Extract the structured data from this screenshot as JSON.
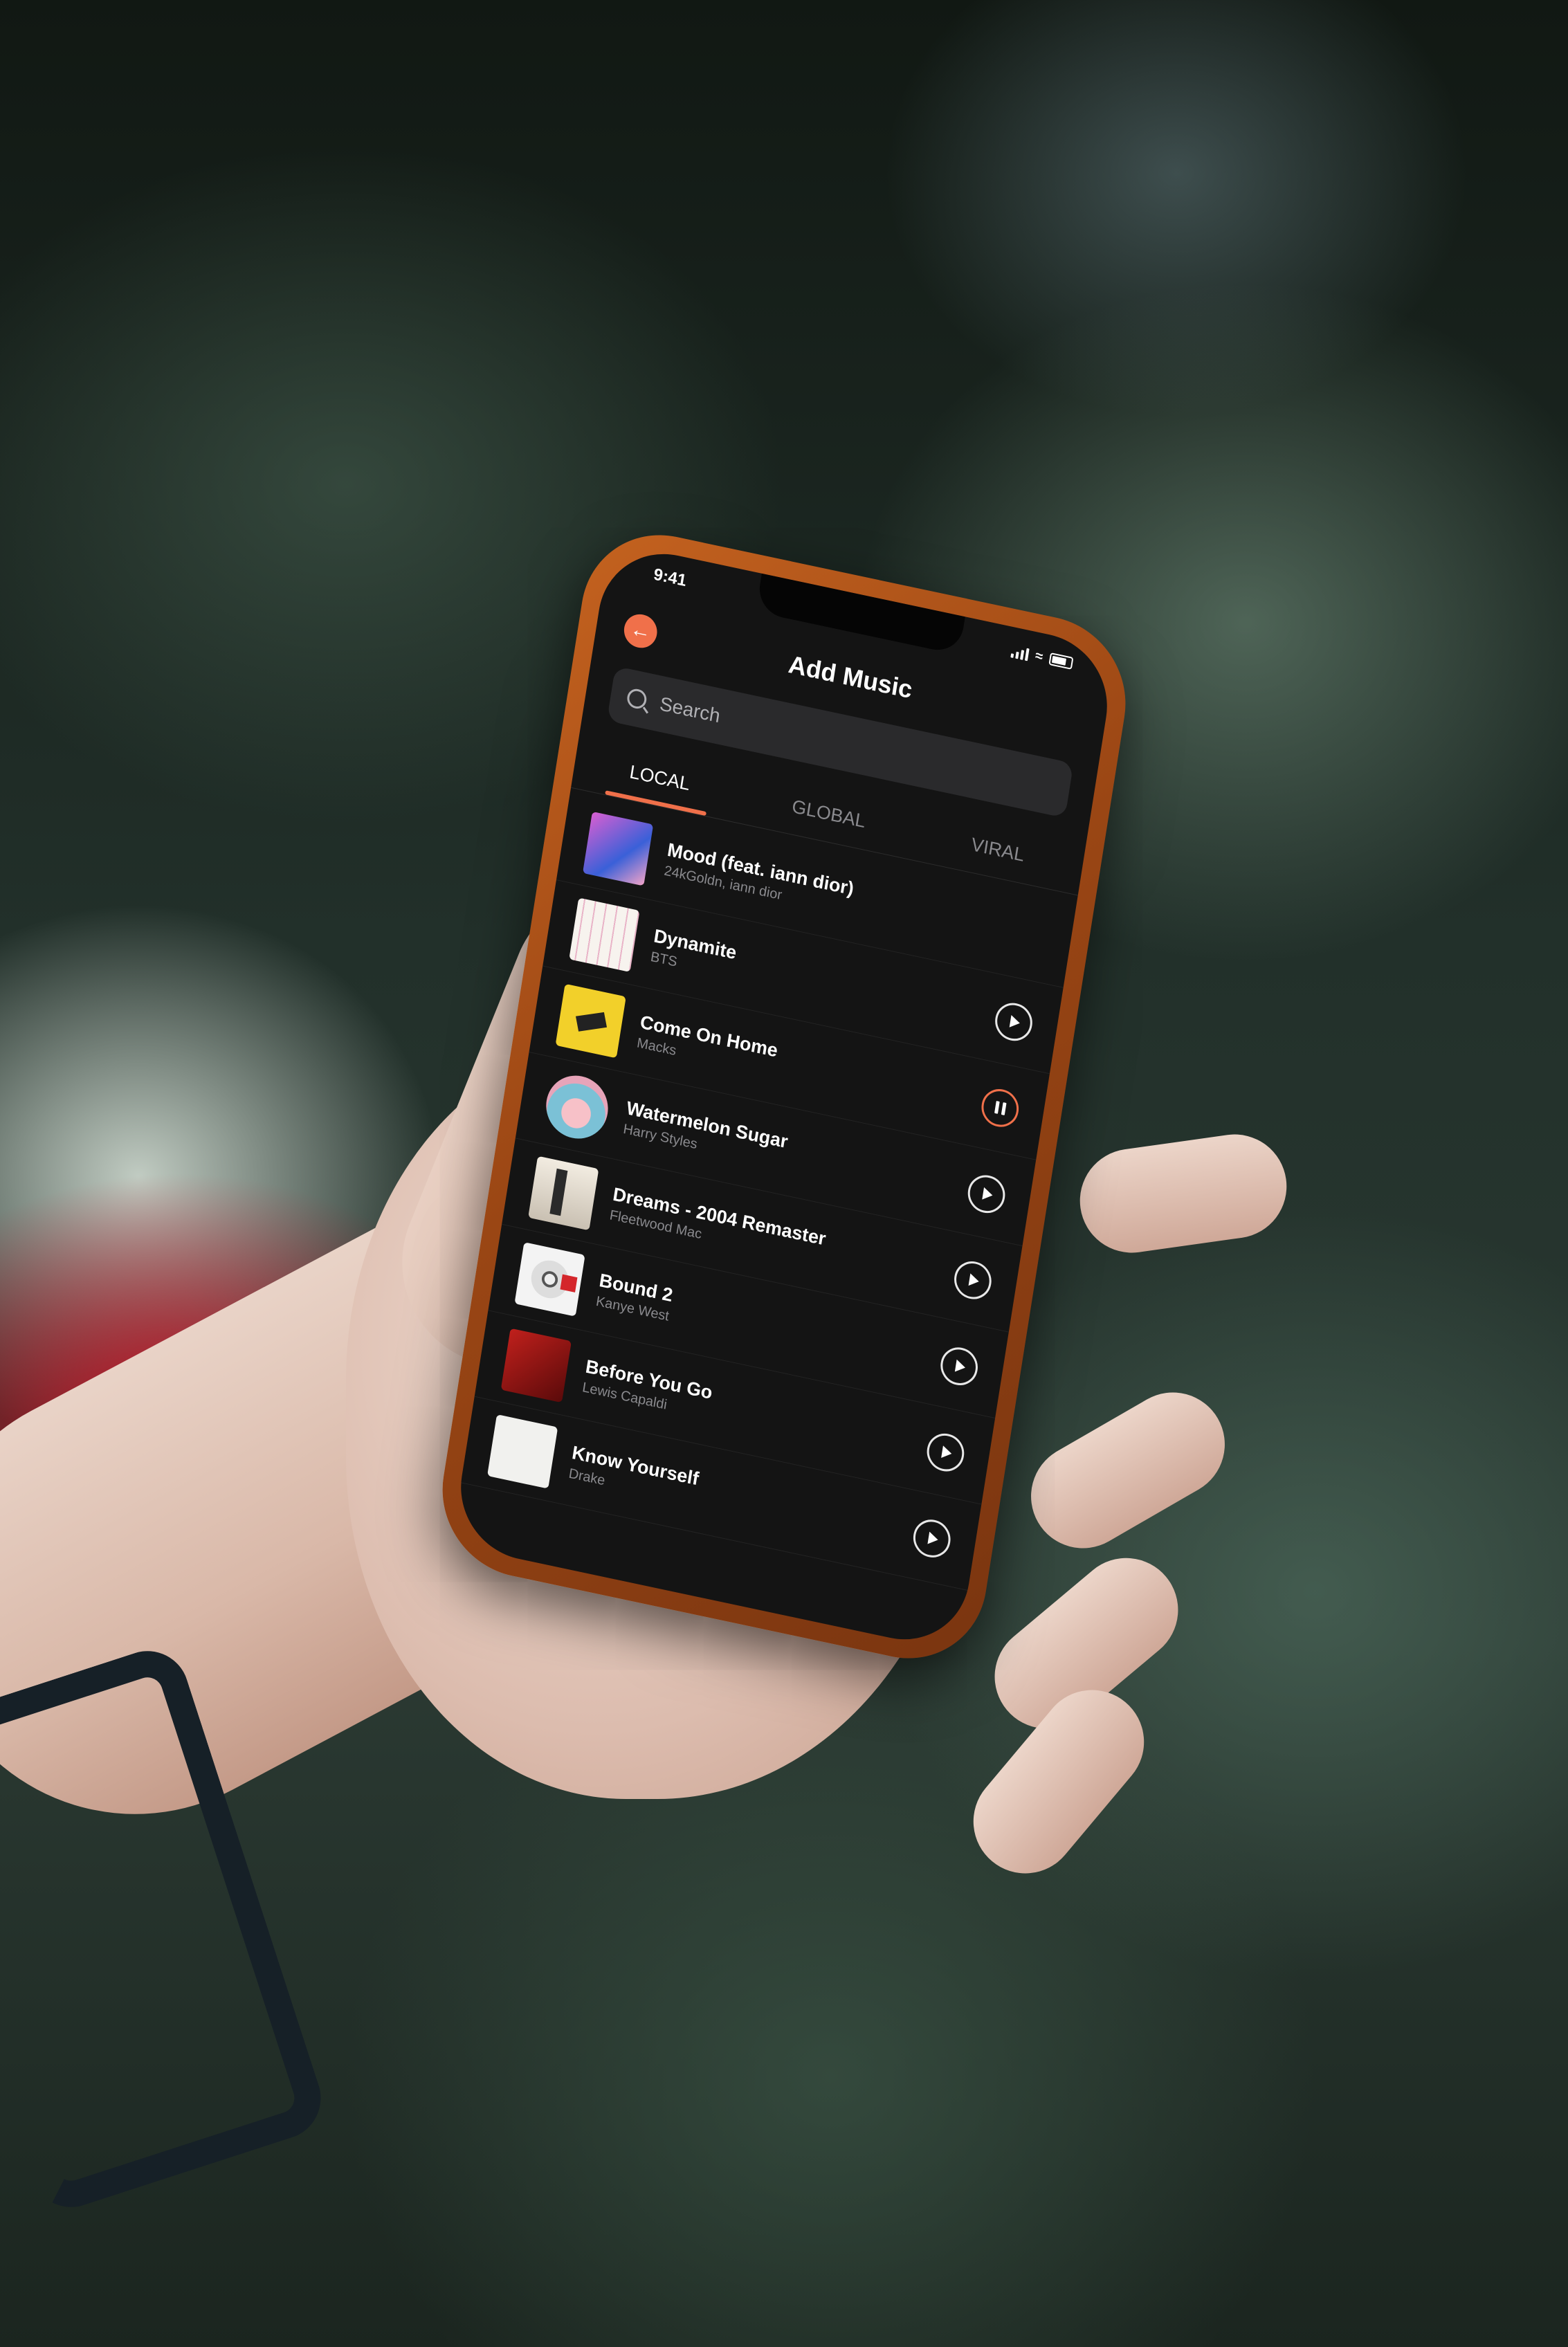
{
  "status_bar": {
    "time": "9:41"
  },
  "header": {
    "title": "Add Music",
    "back_icon": "arrow-left-icon"
  },
  "search": {
    "placeholder": "Search"
  },
  "tabs": [
    {
      "label": "LOCAL",
      "active": true
    },
    {
      "label": "GLOBAL",
      "active": false
    },
    {
      "label": "VIRAL",
      "active": false
    }
  ],
  "songs": [
    {
      "title": "Mood (feat. iann dior)",
      "artist": "24kGoldn, iann dior",
      "state": "none"
    },
    {
      "title": "Dynamite",
      "artist": "BTS",
      "state": "play"
    },
    {
      "title": "Come On Home",
      "artist": "Macks",
      "state": "pause"
    },
    {
      "title": "Watermelon Sugar",
      "artist": "Harry Styles",
      "state": "play"
    },
    {
      "title": "Dreams - 2004 Remaster",
      "artist": "Fleetwood Mac",
      "state": "play"
    },
    {
      "title": "Bound 2",
      "artist": "Kanye West",
      "state": "play"
    },
    {
      "title": "Before You Go",
      "artist": "Lewis Capaldi",
      "state": "play"
    },
    {
      "title": "Know Yourself",
      "artist": "Drake",
      "state": "play"
    }
  ],
  "colors": {
    "accent": "#f0704a",
    "background": "#141414",
    "case": "#9a4614"
  }
}
